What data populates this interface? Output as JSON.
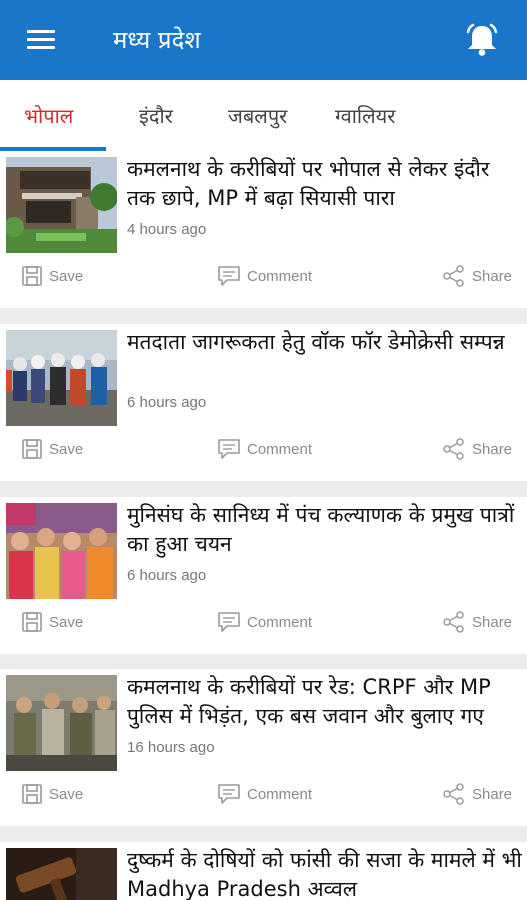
{
  "app_bar": {
    "title": "मध्य प्रदेश",
    "menu_icon": "menu-icon",
    "bell_icon": "bell-icon"
  },
  "tabs": [
    {
      "label": "भोपाल",
      "active": true
    },
    {
      "label": "इंदौर",
      "active": false
    },
    {
      "label": "जबलपुर",
      "active": false
    },
    {
      "label": "ग्वालियर",
      "active": false
    }
  ],
  "colors": {
    "app_bar": "#1976c8",
    "active_tab_text": "#d9262c",
    "tab_indicator": "#1976c8",
    "background": "#ececec"
  },
  "actions": {
    "save_label": "Save",
    "comment_label": "Comment",
    "share_label": "Share"
  },
  "articles": [
    {
      "headline": "कमलनाथ के करीबियों पर भोपाल से लेकर इंदौर तक छापे, MP में बढ़ा सियासी पारा",
      "time": "4 hours ago",
      "thumbnail": "modern-house-photo"
    },
    {
      "headline": "मतदाता जागरूकता हेतु वॉक फॉर डेमोक्रेसी सम्पन्न",
      "time": "6 hours ago",
      "thumbnail": "walk-group-photo"
    },
    {
      "headline": "मुनिसंघ के सानिध्य में पंच कल्याणक के प्रमुख पात्रों का हुआ चयन",
      "time": "6 hours ago",
      "thumbnail": "women-gathering-photo"
    },
    {
      "headline": "कमलनाथ के करीबियों पर रेड: CRPF और MP पुलिस में भिड़ंत, एक बस जवान और बुलाए गए",
      "time": "16 hours ago",
      "thumbnail": "police-photo"
    },
    {
      "headline": "दुष्कर्म के दोषियों को फांसी की सजा के मामले में भी Madhya Pradesh अव्वल",
      "time": "",
      "thumbnail": "gavel-photo"
    }
  ]
}
